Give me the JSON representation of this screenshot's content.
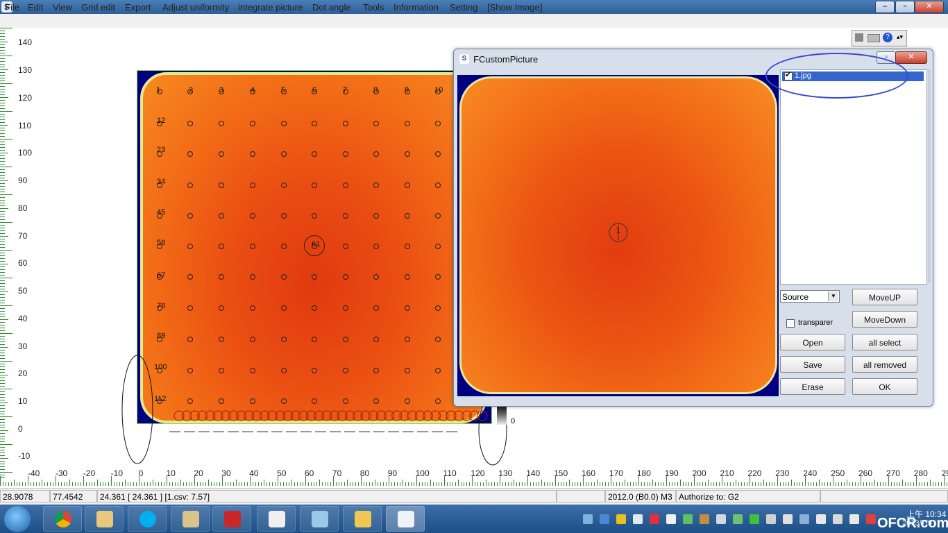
{
  "window": {
    "minimize": "–",
    "maximize": "▫",
    "close": "✕"
  },
  "menu": [
    "File",
    "Edit",
    "View",
    "Grid edit",
    "Export",
    "Adjust uniformity",
    "integrate picture",
    "Dot angle",
    "Tools",
    "Information",
    "Setting",
    "[Show Image]"
  ],
  "ruler_y": [
    "140",
    "130",
    "120",
    "110",
    "100",
    "90",
    "80",
    "70",
    "60",
    "50",
    "40",
    "30",
    "20",
    "10",
    "0",
    "-10"
  ],
  "ruler_x": [
    "-40",
    "-30",
    "-20",
    "-10",
    "0",
    "10",
    "20",
    "30",
    "40",
    "50",
    "60",
    "70",
    "80",
    "90",
    "100",
    "110",
    "120",
    "130",
    "140",
    "150",
    "160",
    "170",
    "180",
    "190",
    "200",
    "210",
    "220",
    "230",
    "240",
    "250",
    "260",
    "270",
    "280",
    "29"
  ],
  "dot_labels": [
    "1",
    "2",
    "3",
    "4",
    "5",
    "6",
    "7",
    "8",
    "9",
    "10",
    "12",
    "23",
    "34",
    "45",
    "56",
    "67",
    "78",
    "89",
    "100",
    "112",
    "61"
  ],
  "scale_zero": "0",
  "dialog": {
    "title": "FCustomPicture",
    "list_item": "1.jpg",
    "crosshair_label": "1",
    "source_value": "Source",
    "transparent_label": "transparer",
    "buttons": {
      "move_up": "MoveUP",
      "move_down": "MoveDown",
      "open": "Open",
      "all_select": "all select",
      "save": "Save",
      "all_removed": "all removed",
      "erase": "Erase",
      "ok": "OK"
    }
  },
  "status": {
    "x": "28.9078",
    "y": "77.4542",
    "value": "24.361 [ 24.361 ] [1.csv: 7.57]",
    "version": "2012.0 (B0.0) M3",
    "authorize": "Authorize to: G2"
  },
  "clock": {
    "time": "上午 10:34",
    "date": "2013/7/9"
  },
  "watermark": "OFCR.com",
  "colors": {
    "heat_center": "#e03a10",
    "heat_edge": "#f78a20",
    "background_blue": "#000080",
    "highlight": "#3a48d0"
  }
}
